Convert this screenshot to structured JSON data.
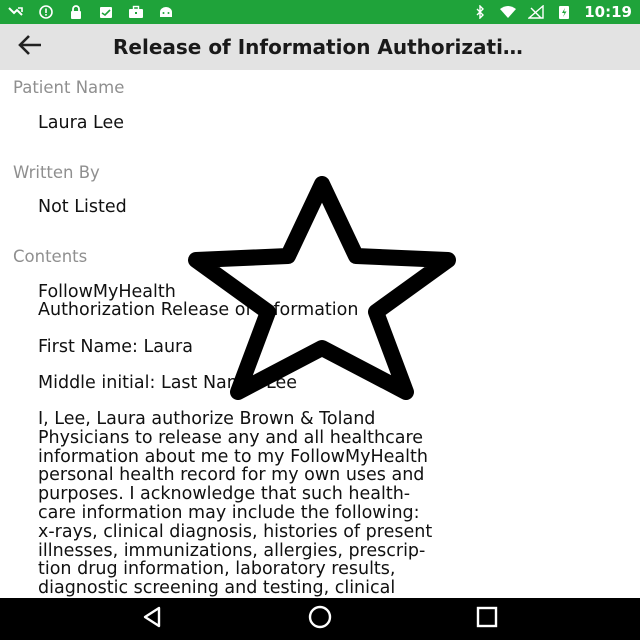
{
  "status_bar": {
    "time": "10:19",
    "left_icons": [
      "missed-call-icon",
      "alert-circle-icon",
      "lock-icon",
      "clipboard-icon",
      "briefcase-icon",
      "android-icon"
    ],
    "right_icons": [
      "bluetooth-icon",
      "wifi-icon",
      "no-signal-icon",
      "battery-charging-icon"
    ],
    "bar_color": "#1fa33a"
  },
  "app_bar": {
    "title": "Release of Information Authorizati…"
  },
  "patient": {
    "label": "Patient Name",
    "value": "Laura Lee"
  },
  "written_by": {
    "label": "Written By",
    "value": "Not Listed"
  },
  "contents": {
    "label": "Contents",
    "line1": "FollowMyHealth",
    "line2": "Authorization Release of Information",
    "first_name": "First Name: Laura",
    "middle_last": "Middle initial:  Last Name: Lee",
    "paragraph": "I, Lee, Laura  authorize Brown & Toland\nPhysicians to release any and all healthcare\ninformation about me to my FollowMyHealth\npersonal health record for my own uses and\npurposes. I acknowledge that such health-\ncare information may include the following:\nx-rays, clinical diagnosis, histories of present\nillnesses, immunizations, allergies, prescrip-\ntion drug information, laboratory results,\ndiagnostic screening and testing, clinical\nnotes and summaries, and medical opinions"
  },
  "overlay": {
    "icon": "star-outline-icon"
  },
  "nav_bar": {
    "buttons": [
      "back-triangle-icon",
      "home-circle-icon",
      "recents-square-icon"
    ]
  }
}
